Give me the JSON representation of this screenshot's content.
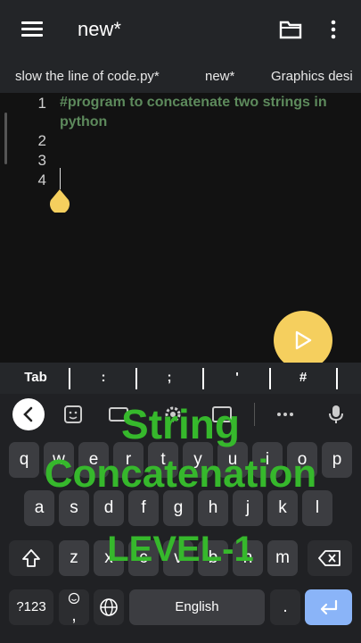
{
  "appbar": {
    "title": "new*"
  },
  "tabs": [
    "slow the line of code.py*",
    "new*",
    "Graphics desi"
  ],
  "editor": {
    "line_numbers": [
      "1",
      "2",
      "3",
      "4"
    ],
    "code_line1": "#program to concatenate two strings in",
    "code_line1_wrap": "python"
  },
  "symbols": [
    "Tab",
    ":",
    ";",
    "'",
    "#"
  ],
  "keyboard": {
    "row1": [
      "q",
      "w",
      "e",
      "r",
      "t",
      "y",
      "u",
      "i",
      "o",
      "p"
    ],
    "row2": [
      "a",
      "s",
      "d",
      "f",
      "g",
      "h",
      "j",
      "k",
      "l"
    ],
    "row3": [
      "z",
      "x",
      "c",
      "v",
      "b",
      "n",
      "m"
    ],
    "numbers_label": "?123",
    "comma": ",",
    "space_label": "English",
    "period": "."
  },
  "overlay": {
    "line1": "String",
    "line2": "Concatenation",
    "line3": "LEVEL-1"
  },
  "colors": {
    "accent": "#f5cf5e",
    "overlay_text": "#36b82c",
    "comment": "#5d8a5c",
    "enter_key": "#8ab4f8"
  },
  "icons": [
    "menu-icon",
    "folder-icon",
    "kebab-icon",
    "play-icon",
    "back-icon",
    "sticker-icon",
    "gif-icon",
    "settings-icon",
    "translate-icon",
    "more-icon",
    "mic-icon",
    "shift-icon",
    "backspace-icon",
    "emoji-icon",
    "globe-icon",
    "enter-icon"
  ]
}
